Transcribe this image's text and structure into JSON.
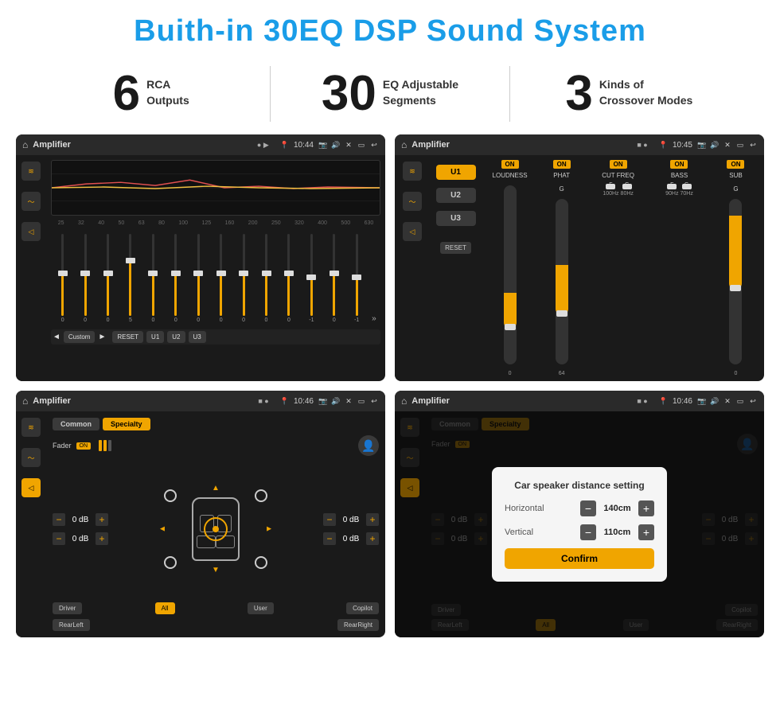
{
  "page": {
    "title": "Buith-in 30EQ DSP Sound System",
    "stats": [
      {
        "number": "6",
        "label": "RCA\nOutputs"
      },
      {
        "number": "30",
        "label": "EQ Adjustable\nSegments"
      },
      {
        "number": "3",
        "label": "Kinds of\nCrossover Modes"
      }
    ]
  },
  "screens": [
    {
      "id": "screen1",
      "topbar": {
        "title": "Amplifier",
        "time": "10:44",
        "status": "●  ▶"
      },
      "type": "eq",
      "freqs": [
        "25",
        "32",
        "40",
        "50",
        "63",
        "80",
        "100",
        "125",
        "160",
        "200",
        "250",
        "320",
        "400",
        "500",
        "630"
      ],
      "values": [
        "0",
        "0",
        "0",
        "5",
        "0",
        "0",
        "0",
        "0",
        "0",
        "0",
        "0",
        "-1",
        "0",
        "-1"
      ],
      "preset": "Custom",
      "buttons": [
        "◄",
        "Custom",
        "►",
        "RESET",
        "U1",
        "U2",
        "U3"
      ]
    },
    {
      "id": "screen2",
      "topbar": {
        "title": "Amplifier",
        "time": "10:45",
        "status": "■  ●"
      },
      "type": "crossover",
      "uButtons": [
        "U1",
        "U2",
        "U3"
      ],
      "columns": [
        {
          "label": "LOUDNESS",
          "on": true
        },
        {
          "label": "PHAT",
          "on": true
        },
        {
          "label": "CUT FREQ",
          "on": true
        },
        {
          "label": "BASS",
          "on": true
        },
        {
          "label": "SUB",
          "on": true
        }
      ]
    },
    {
      "id": "screen3",
      "topbar": {
        "title": "Amplifier",
        "time": "10:46",
        "status": "■  ●"
      },
      "type": "speaker",
      "tabs": [
        "Common",
        "Specialty"
      ],
      "activeTab": "Specialty",
      "fader": {
        "label": "Fader",
        "on": true
      },
      "volumes": [
        {
          "label": "0 dB"
        },
        {
          "label": "0 dB"
        },
        {
          "label": "0 dB"
        },
        {
          "label": "0 dB"
        }
      ],
      "buttons": [
        "Driver",
        "RearLeft",
        "All",
        "User",
        "Copilot",
        "RearRight"
      ]
    },
    {
      "id": "screen4",
      "topbar": {
        "title": "Amplifier",
        "time": "10:46",
        "status": "■  ●"
      },
      "type": "speaker-dialog",
      "tabs": [
        "Common",
        "Specialty"
      ],
      "dialog": {
        "title": "Car speaker distance setting",
        "horizontal": {
          "label": "Horizontal",
          "value": "140cm"
        },
        "vertical": {
          "label": "Vertical",
          "value": "110cm"
        },
        "confirm": "Confirm"
      },
      "buttons": [
        "Driver",
        "RearLeft",
        "All",
        "User",
        "Copilot",
        "RearRight"
      ]
    }
  ]
}
